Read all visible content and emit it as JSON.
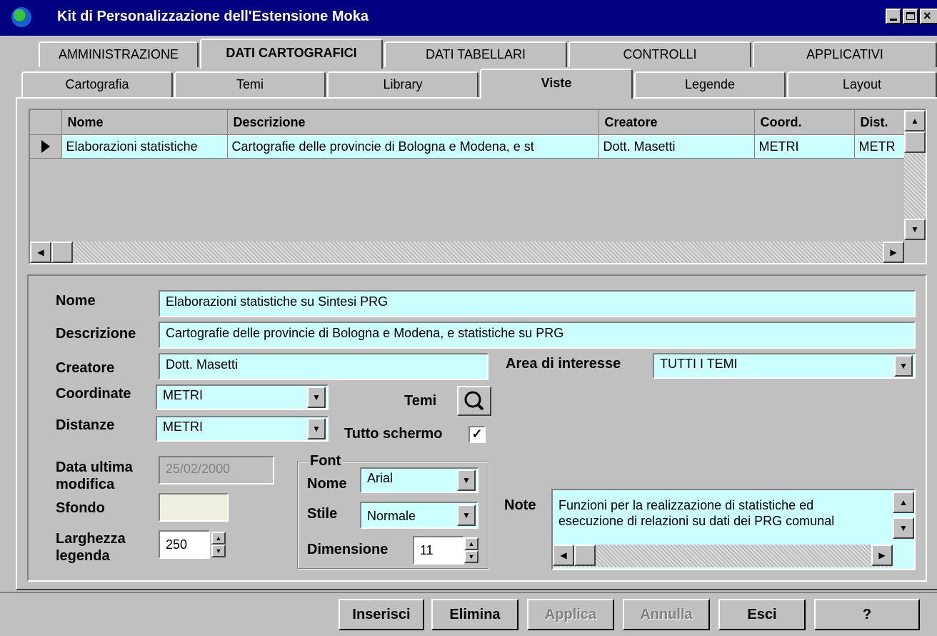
{
  "window": {
    "title": "Kit di Personalizzazione dell'Estensione Moka",
    "minimize_label": "_",
    "maximize_label": "□",
    "close_label": "×"
  },
  "tabs_main": [
    {
      "label": "AMMINISTRAZIONE"
    },
    {
      "label": "DATI CARTOGRAFICI",
      "active": true
    },
    {
      "label": "DATI TABELLARI"
    },
    {
      "label": "CONTROLLI"
    },
    {
      "label": "APPLICATIVI"
    }
  ],
  "tabs_sub": [
    {
      "label": "Cartografia"
    },
    {
      "label": "Temi"
    },
    {
      "label": "Library"
    },
    {
      "label": "Viste",
      "active": true
    },
    {
      "label": "Legende"
    },
    {
      "label": "Layout"
    }
  ],
  "grid": {
    "columns": [
      "Nome",
      "Descrizione",
      "Creatore",
      "Coord.",
      "Dist."
    ],
    "rows": [
      [
        "Elaborazioni statistiche",
        "Cartografie delle provincie di Bologna e Modena, e st",
        "Dott. Masetti",
        "METRI",
        "METR"
      ]
    ]
  },
  "form": {
    "nome_label": "Nome",
    "nome_value": "Elaborazioni statistiche su Sintesi PRG",
    "descrizione_label": "Descrizione",
    "descrizione_value": "Cartografie delle provincie di Bologna e Modena, e statistiche su PRG",
    "creatore_label": "Creatore",
    "creatore_value": "Dott. Masetti",
    "area_label": "Area di interesse",
    "area_value": "TUTTI I TEMI",
    "coordinate_label": "Coordinate",
    "coordinate_value": "METRI",
    "distanze_label": "Distanze",
    "distanze_value": "METRI",
    "temi_label": "Temi",
    "tutto_schermo_label": "Tutto schermo",
    "tutto_schermo_checked": true,
    "data_label_1": "Data ultima",
    "data_label_2": "modifica",
    "data_value": "25/02/2000",
    "sfondo_label": "Sfondo",
    "larghezza_label_1": "Larghezza",
    "larghezza_label_2": "legenda",
    "larghezza_value": "250",
    "font": {
      "group_label": "Font",
      "nome_label": "Nome",
      "nome_value": "Arial",
      "stile_label": "Stile",
      "stile_value": "Normale",
      "dimensione_label": "Dimensione",
      "dimensione_value": "11"
    },
    "note_label": "Note",
    "note_line1": "Funzioni per la realizzazione di statistiche ed",
    "note_line2": "esecuzione di relazioni su dati dei PRG comunal"
  },
  "buttons": {
    "inserisci": "Inserisci",
    "elimina": "Elimina",
    "applica": "Applica",
    "annulla": "Annulla",
    "esci": "Esci",
    "help": "?"
  },
  "colors": {
    "field_bg": "#ccffff",
    "titlebar": "#000080",
    "face": "#c0c0c0"
  }
}
